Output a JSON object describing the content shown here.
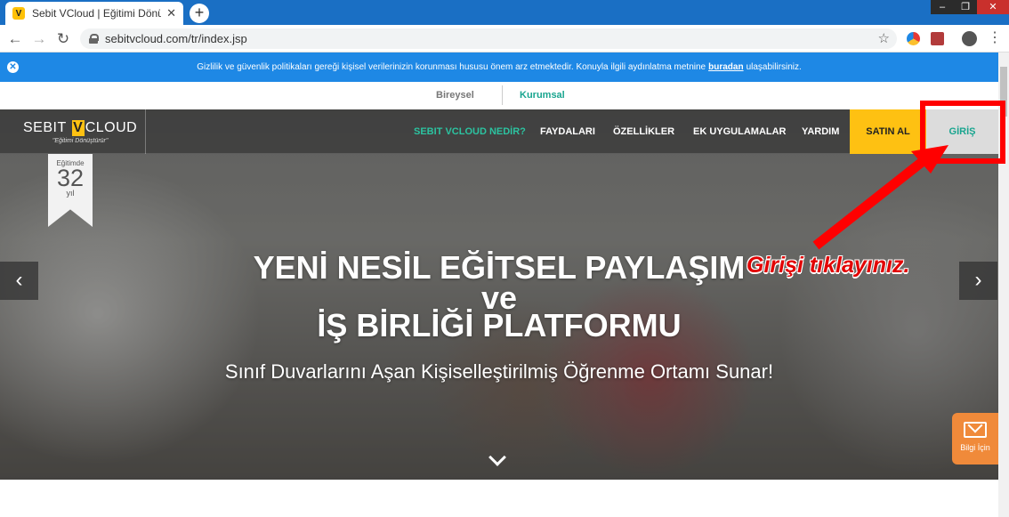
{
  "browser": {
    "tab_title": "Sebit VCloud | Eğitimi Dönüştürür",
    "tab_favicon": "V",
    "tab_close": "✕",
    "new_tab": "+",
    "url": "sebitvcloud.com/tr/index.jsp",
    "window_controls": {
      "minimize": "–",
      "maximize": "❐",
      "close": "✕"
    }
  },
  "notice": {
    "text_before": "Gizlilik ve güvenlik politikaları gereği kişisel verilerinizin korunması hususu önem arz etmektedir. Konuyla ilgili aydınlatma metnine",
    "link": "buradan",
    "text_after": "ulaşabilirsiniz."
  },
  "segments": [
    "Bireysel",
    "Kurumsal"
  ],
  "logo": {
    "before": "SEBIT ",
    "v": "V",
    "after": "CLOUD",
    "tagline": "\"Eğitimi Dönüştürür\""
  },
  "nav": {
    "items": [
      "SEBIT VCLOUD NEDİR?",
      "FAYDALARI",
      "ÖZELLİKLER",
      "EK UYGULAMALAR",
      "YARDIM"
    ],
    "buy": "SATIN AL",
    "login": "GİRİŞ"
  },
  "badge": {
    "top": "Eğitimde",
    "number": "32",
    "bottom": "yıl"
  },
  "hero": {
    "line1": "YENİ NESİL EĞİTSEL PAYLAŞIM",
    "line2": "ve",
    "line3": "İŞ BİRLİĞİ PLATFORMU",
    "subtitle": "Sınıf Duvarlarını Aşan Kişiselleştirilmiş Öğrenme Ortamı Sunar!"
  },
  "annotation": "Girişi tıklayınız.",
  "info_button": "Bilgi İçin",
  "colors": {
    "accent_teal": "#19a58f",
    "accent_yellow": "#fec112",
    "notice_blue": "#1e88e5",
    "highlight_red": "#ff0000",
    "info_orange": "#f08a3a"
  }
}
